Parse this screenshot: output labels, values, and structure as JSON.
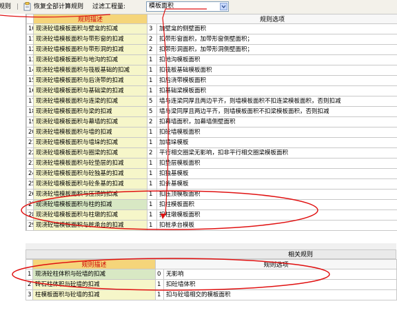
{
  "toolbar": {
    "rules_label": "规则",
    "restore_label": "恢复全部计算规则",
    "filter_label": "过滤工程量:",
    "filter_value": "模板面积"
  },
  "main": {
    "col_desc": "规则描述",
    "col_opt": "规则选项",
    "rows": [
      {
        "n": "10",
        "desc": "现浇砼墙模板面积与壁龛的扣减",
        "code": "3",
        "opt": "加壁龛的侧壁面积"
      },
      {
        "n": "11",
        "desc": "现浇砼墙模板面积与带形窗的扣减",
        "code": "2",
        "opt": "扣带形窗面积，加带形窗侧壁面积；"
      },
      {
        "n": "12",
        "desc": "现浇砼墙模板面积与带形洞的扣减",
        "code": "2",
        "opt": "扣带形洞面积，加带形洞侧壁面积；"
      },
      {
        "n": "13",
        "desc": "现浇砼墙模板面积与地沟的扣减",
        "code": "1",
        "opt": "扣地沟模板面积"
      },
      {
        "n": "14",
        "desc": "现浇砼墙模板面积与筏板基础的扣减",
        "code": "1",
        "opt": "扣筏板基础模板面积"
      },
      {
        "n": "15",
        "desc": "现浇砼墙模板面积与后浇带的扣减",
        "code": "1",
        "opt": "扣后浇带模板面积"
      },
      {
        "n": "16",
        "desc": "现浇砼墙模板面积与基础梁的扣减",
        "code": "1",
        "opt": "扣基础梁模板面积"
      },
      {
        "n": "17",
        "desc": "现浇砼墙模板面积与连梁的扣减",
        "code": "5",
        "opt": "墙与连梁同厚且两边平齐，则墙模板面积不扣连梁模板面积，否则扣减"
      },
      {
        "n": "18",
        "desc": "现浇砼墙模板面积与梁的扣减",
        "code": "5",
        "opt": "墙与梁同厚且两边平齐，则墙模板面积不扣梁模板面积，否则扣减"
      },
      {
        "n": "19",
        "desc": "现浇砼墙模板面积与幕墙的扣减",
        "code": "2",
        "opt": "扣幕墙面积，加幕墙侧壁面积"
      },
      {
        "n": "20",
        "desc": "现浇砼墙模板面积与墙的扣减",
        "code": "1",
        "opt": "扣砼墙模板面积"
      },
      {
        "n": "21",
        "desc": "现浇砼墙模板面积与墙垛的扣减",
        "code": "1",
        "opt": "加墙垛模板"
      },
      {
        "n": "22",
        "desc": "现浇砼墙模板面积与圈梁的扣减",
        "code": "2",
        "opt": "平行相交圈梁无影响，扣非平行相交圈梁模板面积"
      },
      {
        "n": "23",
        "desc": "现浇砼墙模板面积与砼垫层的扣减",
        "code": "1",
        "opt": "扣垫层模板面积"
      },
      {
        "n": "24",
        "desc": "现浇砼墙模板面积与砼独基的扣减",
        "code": "1",
        "opt": "扣独基模板"
      },
      {
        "n": "25",
        "desc": "现浇砼墙模板面积与砼条基的扣减",
        "code": "1",
        "opt": "扣条基模板"
      },
      {
        "n": "26",
        "desc": "现浇砼墙模板面积与压顶的扣减",
        "code": "1",
        "opt": "扣压顶模板面积"
      },
      {
        "n": "27",
        "desc": "现浇砼墙模板面积与柱的扣减",
        "code": "1",
        "opt": "扣柱模板面积"
      },
      {
        "n": "28",
        "desc": "现浇砼墙模板面积与柱墩的扣减",
        "code": "1",
        "opt": "扣柱墩模板面积"
      },
      {
        "n": "29",
        "desc": "现浇砼墙模板面积与桩承台的扣减",
        "code": "1",
        "opt": "扣桩承台模板"
      }
    ]
  },
  "related": {
    "title": "相关规则",
    "col_desc": "规则描述",
    "col_opt": "规则选项",
    "rows": [
      {
        "n": "1",
        "desc": "现浇砼柱体积与砼墙的扣减",
        "code": "0",
        "opt": "无影响"
      },
      {
        "n": "2",
        "desc": "砖石柱体积与砼墙的扣减",
        "code": "1",
        "opt": "扣砼墙体积"
      },
      {
        "n": "3",
        "desc": "柱模板面积与砼墙的扣减",
        "code": "1",
        "opt": "扣与砼墙相交的模板面积"
      }
    ]
  },
  "colors": {
    "annotation": "#e01010",
    "header": "#f5d57a",
    "desc_bg": "#f6f6c9"
  }
}
